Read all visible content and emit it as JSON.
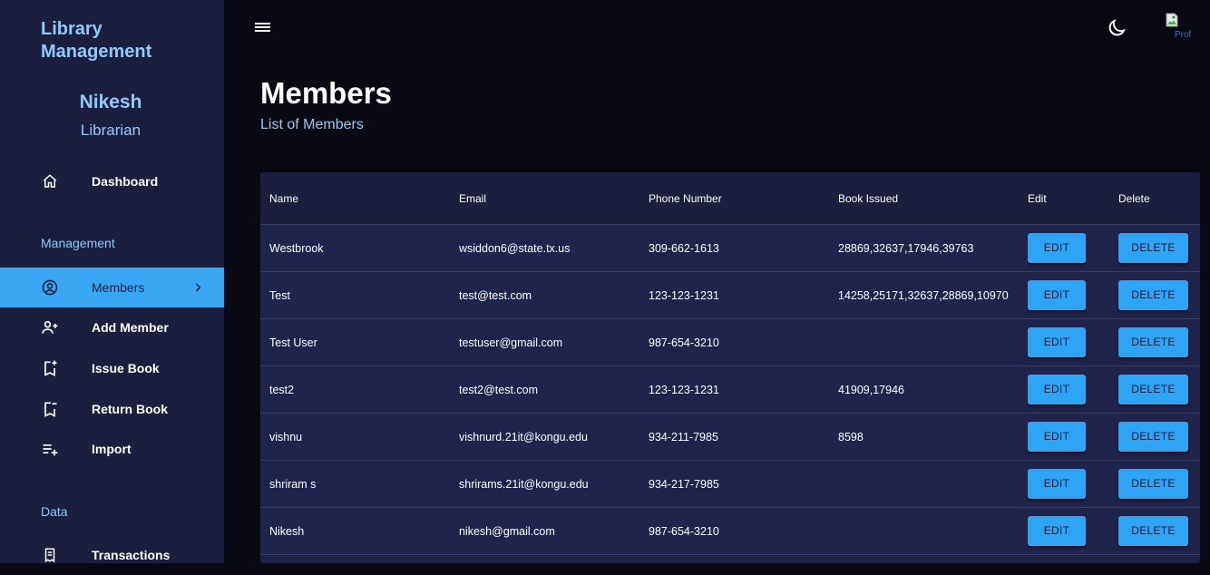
{
  "sidebar": {
    "brand": "Library Management",
    "user_name": "Nikesh",
    "user_role": "Librarian",
    "dashboard_label": "Dashboard",
    "management_label": "Management",
    "data_label": "Data",
    "items": [
      {
        "label": "Members",
        "icon": "account-circle-icon",
        "active": true
      },
      {
        "label": "Add Member",
        "icon": "person-add-icon"
      },
      {
        "label": "Issue Book",
        "icon": "bookmark-add-icon"
      },
      {
        "label": "Return Book",
        "icon": "bookmark-remove-icon"
      },
      {
        "label": "Import",
        "icon": "playlist-add-icon"
      },
      {
        "label": "Transactions",
        "icon": "receipt-icon"
      }
    ]
  },
  "topbar": {
    "avatar_alt": "Profil"
  },
  "header": {
    "title": "Members",
    "subtitle": "List of Members"
  },
  "table": {
    "columns": [
      "Name",
      "Email",
      "Phone Number",
      "Book Issued",
      "Edit",
      "Delete"
    ],
    "edit_label": "EDIT",
    "delete_label": "DELETE",
    "rows": [
      {
        "name": "Westbrook",
        "email": "wsiddon6@state.tx.us",
        "phone": "309-662-1613",
        "books": "28869,32637,17946,39763"
      },
      {
        "name": "Test",
        "email": "test@test.com",
        "phone": "123-123-1231",
        "books": "14258,25171,32637,28869,10970"
      },
      {
        "name": "Test User",
        "email": "testuser@gmail.com",
        "phone": "987-654-3210",
        "books": ""
      },
      {
        "name": "test2",
        "email": "test2@test.com",
        "phone": "123-123-1231",
        "books": "41909,17946"
      },
      {
        "name": "vishnu",
        "email": "vishnurd.21it@kongu.edu",
        "phone": "934-211-7985",
        "books": "8598"
      },
      {
        "name": "shriram s",
        "email": "shrirams.21it@kongu.edu",
        "phone": "934-217-7985",
        "books": ""
      },
      {
        "name": "Nikesh",
        "email": "nikesh@gmail.com",
        "phone": "987-654-3210",
        "books": ""
      }
    ]
  }
}
